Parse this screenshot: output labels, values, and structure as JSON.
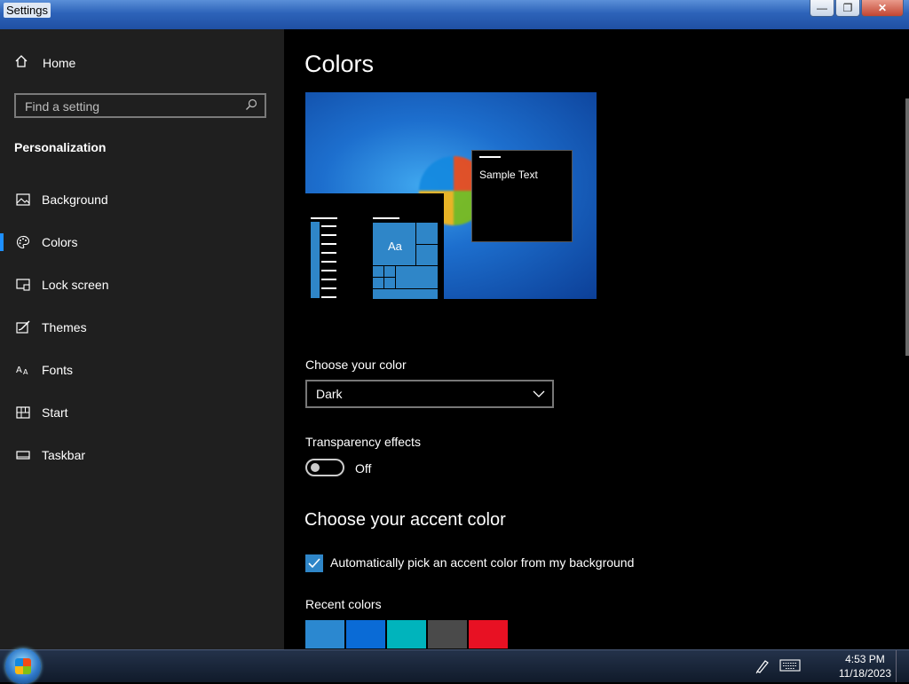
{
  "window": {
    "title": "Settings",
    "minimize": "—",
    "restore": "❐",
    "close": "✕"
  },
  "sidebar": {
    "home_label": "Home",
    "search_placeholder": "Find a setting",
    "section_title": "Personalization",
    "items": [
      {
        "label": "Background",
        "icon": "picture-icon"
      },
      {
        "label": "Colors",
        "icon": "palette-icon",
        "active": true
      },
      {
        "label": "Lock screen",
        "icon": "lock-screen-icon"
      },
      {
        "label": "Themes",
        "icon": "themes-icon"
      },
      {
        "label": "Fonts",
        "icon": "fonts-icon"
      },
      {
        "label": "Start",
        "icon": "start-icon"
      },
      {
        "label": "Taskbar",
        "icon": "taskbar-icon"
      }
    ]
  },
  "main": {
    "title": "Colors",
    "preview": {
      "sample_text": "Sample Text",
      "tile_text": "Aa"
    },
    "choose_color": {
      "label": "Choose your color",
      "value": "Dark"
    },
    "transparency": {
      "label": "Transparency effects",
      "state": "Off"
    },
    "accent": {
      "heading": "Choose your accent color",
      "auto_pick_label": "Automatically pick an accent color from my background",
      "auto_pick_checked": true,
      "recent_label": "Recent colors",
      "recent_colors": [
        "#2b88d0",
        "#0a6bd6",
        "#00b4bc",
        "#4a4a4a",
        "#e81123"
      ]
    }
  },
  "taskbar": {
    "time": "4:53 PM",
    "date": "11/18/2023"
  },
  "colors": {
    "accent": "#2f86c8",
    "sidebar_bg": "#1f1f1f",
    "content_bg": "#000000"
  }
}
